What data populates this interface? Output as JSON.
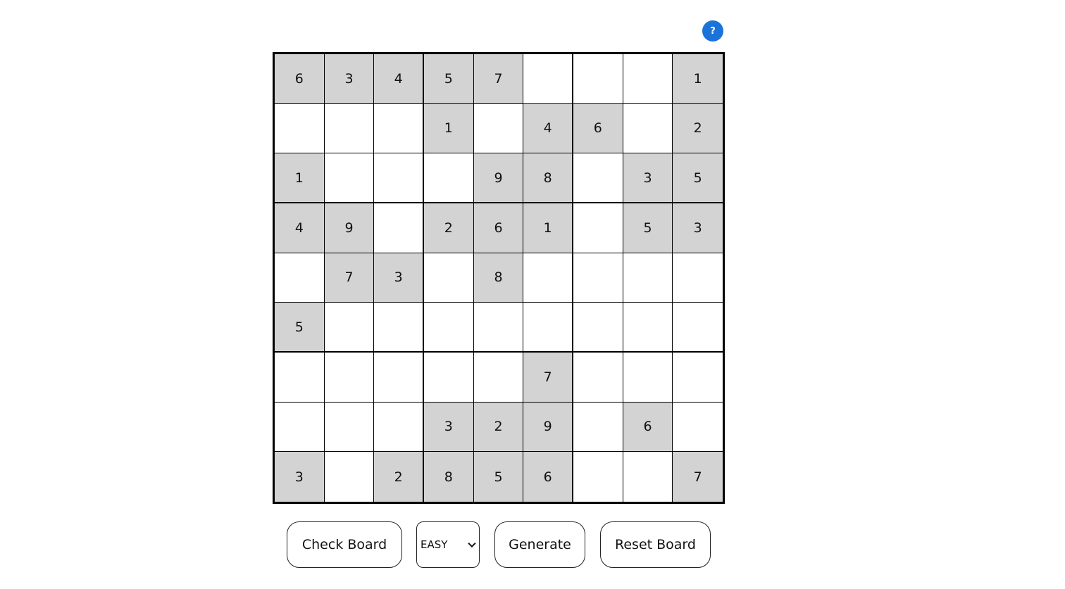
{
  "help": {
    "label": "?"
  },
  "board": {
    "rows": [
      [
        "6",
        "3",
        "4",
        "5",
        "7",
        "",
        "",
        "",
        "1"
      ],
      [
        "",
        "",
        "",
        "1",
        "",
        "4",
        "6",
        "",
        "2"
      ],
      [
        "1",
        "",
        "",
        "",
        "9",
        "8",
        "",
        "3",
        "5"
      ],
      [
        "4",
        "9",
        "",
        "2",
        "6",
        "1",
        "",
        "5",
        "3"
      ],
      [
        "",
        "7",
        "3",
        "",
        "8",
        "",
        "",
        "",
        ""
      ],
      [
        "5",
        "",
        "",
        "",
        "",
        "",
        "",
        "",
        ""
      ],
      [
        "",
        "",
        "",
        "",
        "",
        "7",
        "",
        "",
        ""
      ],
      [
        "",
        "",
        "",
        "3",
        "2",
        "9",
        "",
        "6",
        ""
      ],
      [
        "3",
        "",
        "2",
        "8",
        "5",
        "6",
        "",
        "",
        "7"
      ]
    ]
  },
  "controls": {
    "check_label": "Check Board",
    "difficulty_value": "EASY",
    "generate_label": "Generate",
    "reset_label": "Reset Board"
  },
  "colors": {
    "given_cell": "#d3d3d3",
    "empty_cell": "#ffffff",
    "help_button": "#1a73d9"
  }
}
